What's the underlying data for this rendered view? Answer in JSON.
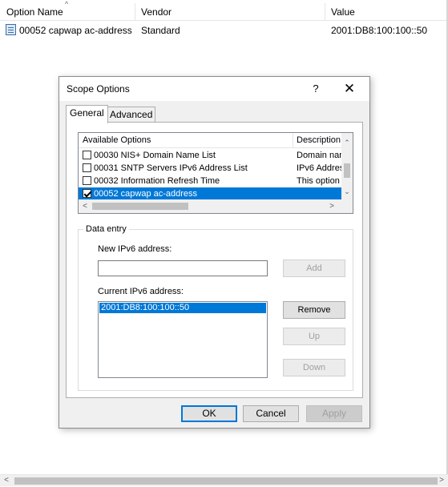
{
  "list_view": {
    "columns": [
      "Option Name",
      "Vendor",
      "Value"
    ],
    "rows": [
      {
        "name": "00052 capwap ac-address",
        "vendor": "Standard",
        "value": "2001:DB8:100:100::50",
        "icon": "option-icon"
      }
    ]
  },
  "dialog": {
    "title": "Scope Options",
    "help_glyph": "?",
    "close_glyph": "✕",
    "tabs": [
      {
        "label": "General",
        "active": true
      },
      {
        "label": "Advanced",
        "active": false
      }
    ],
    "options_list": {
      "headers": [
        "Available Options",
        "Description"
      ],
      "rows": [
        {
          "label": "00030 NIS+ Domain Name List",
          "description": "Domain nam",
          "checked": false,
          "selected": false
        },
        {
          "label": "00031 SNTP Servers IPv6 Address List",
          "description": "IPv6 Addres",
          "checked": false,
          "selected": false
        },
        {
          "label": "00032 Information Refresh Time",
          "description": "This option",
          "checked": false,
          "selected": false
        },
        {
          "label": "00052 capwap ac-address",
          "description": "",
          "checked": true,
          "selected": true
        }
      ]
    },
    "data_entry": {
      "legend": "Data entry",
      "new_address_label": "New IPv6 address:",
      "new_address_value": "",
      "add_label": "Add",
      "current_address_label": "Current IPv6 address:",
      "current_addresses": [
        "2001:DB8:100:100::50"
      ],
      "remove_label": "Remove",
      "up_label": "Up",
      "down_label": "Down"
    },
    "buttons": {
      "ok": "OK",
      "cancel": "Cancel",
      "apply": "Apply"
    }
  },
  "colors": {
    "selection": "#0078d7",
    "dialog_bg": "#f0f0f0"
  }
}
